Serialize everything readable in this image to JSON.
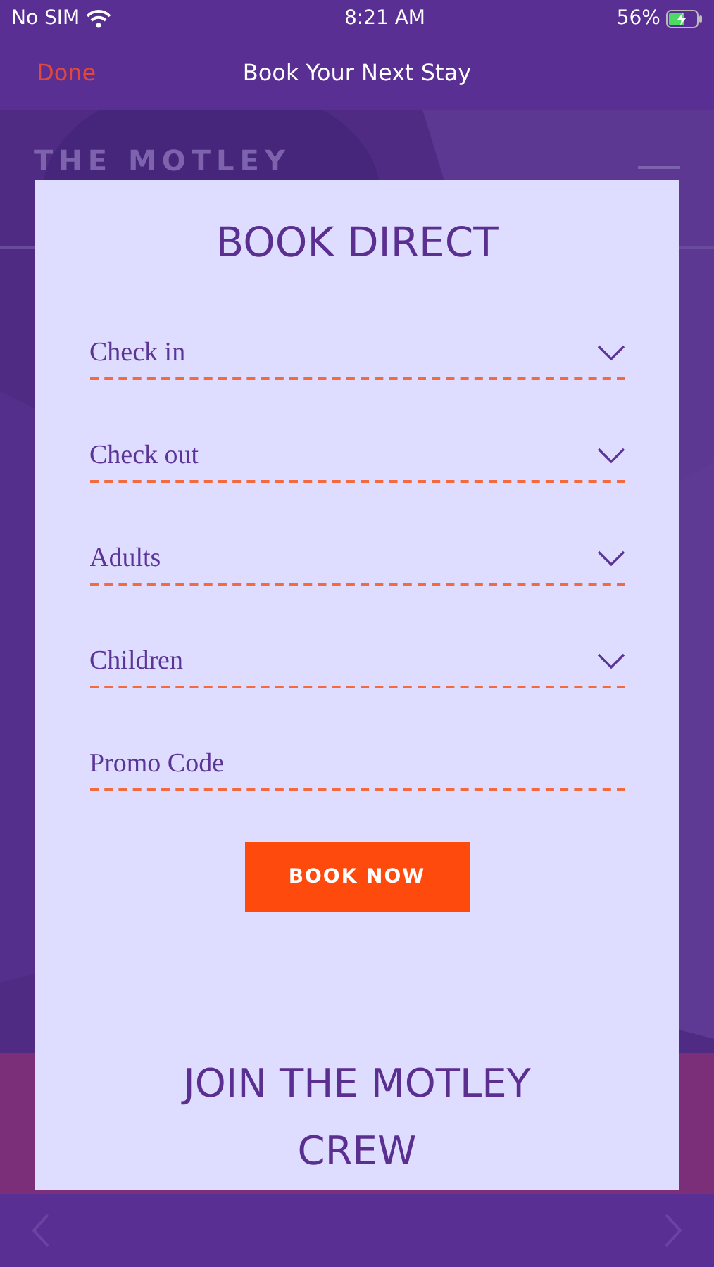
{
  "status_bar": {
    "carrier": "No SIM",
    "time": "8:21 AM",
    "battery": "56%"
  },
  "nav": {
    "done": "Done",
    "title": "Book Your Next Stay"
  },
  "background": {
    "logo": "THE MOTLEY"
  },
  "card": {
    "title": "BOOK DIRECT",
    "fields": [
      {
        "kind": "select",
        "placeholder": "Check in"
      },
      {
        "kind": "select",
        "placeholder": "Check out"
      },
      {
        "kind": "select",
        "placeholder": "Adults"
      },
      {
        "kind": "select",
        "placeholder": "Children"
      },
      {
        "kind": "text",
        "placeholder": "Promo Code"
      }
    ],
    "button": "BOOK NOW",
    "join": "JOIN THE MOTLEY CREW"
  },
  "toolbar": {
    "back_disabled": true,
    "forward_disabled": true
  }
}
